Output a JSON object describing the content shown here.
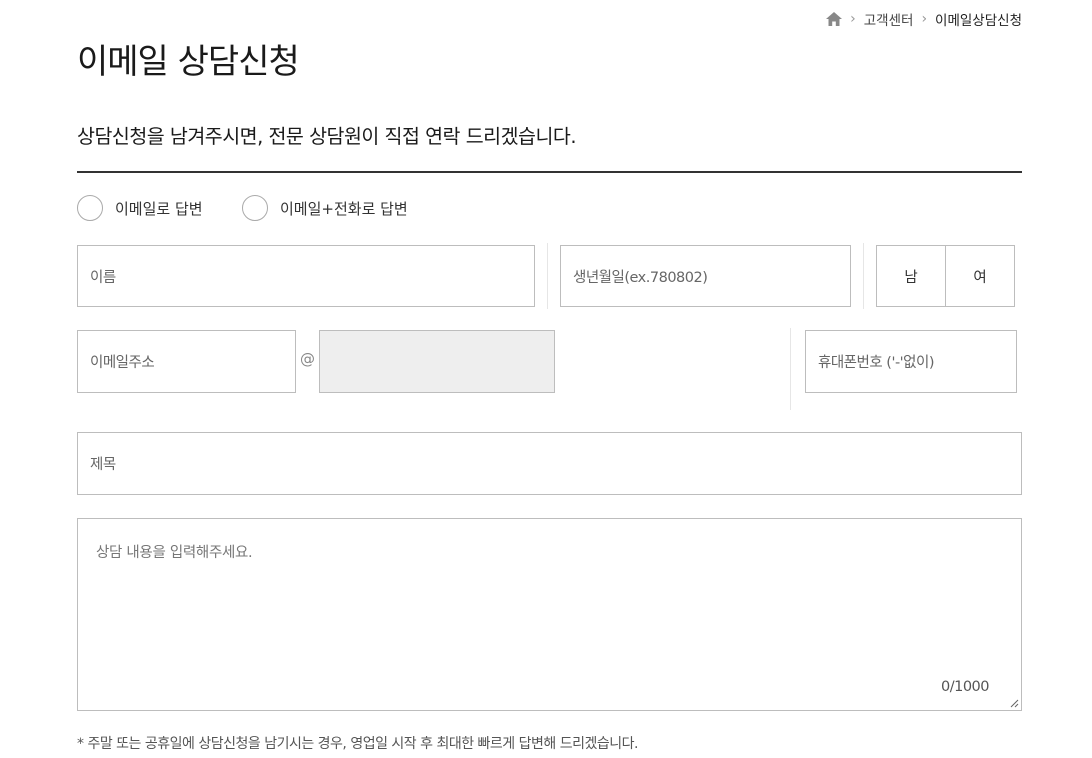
{
  "breadcrumb": {
    "home_icon": "home-icon",
    "items": [
      "고객센터",
      "이메일상담신청"
    ]
  },
  "page": {
    "title": "이메일 상담신청",
    "subtitle": "상담신청을 남겨주시면, 전문 상담원이 직접 연락 드리겠습니다."
  },
  "reply_options": [
    {
      "label": "이메일로 답변",
      "selected": false
    },
    {
      "label": "이메일+전화로 답변",
      "selected": false
    }
  ],
  "form": {
    "name_placeholder": "이름",
    "birth_placeholder": "생년월일(ex.780802)",
    "gender": {
      "male": "남",
      "female": "여"
    },
    "email_placeholder": "이메일주소",
    "at_symbol": "@",
    "phone_placeholder": "휴대폰번호 ('-'없이)",
    "subject_placeholder": "제목",
    "content_placeholder": "상담 내용을 입력해주세요.",
    "counter": "0/1000"
  },
  "notice": "* 주말 또는 공휴일에 상담신청을 남기시는 경우, 영업일 시작 후 최대한 빠르게 답변해 드리겠습니다.",
  "colors": {
    "divider": "#333333",
    "border": "#bdbdbd",
    "disabled_bg": "#eeeeee"
  }
}
